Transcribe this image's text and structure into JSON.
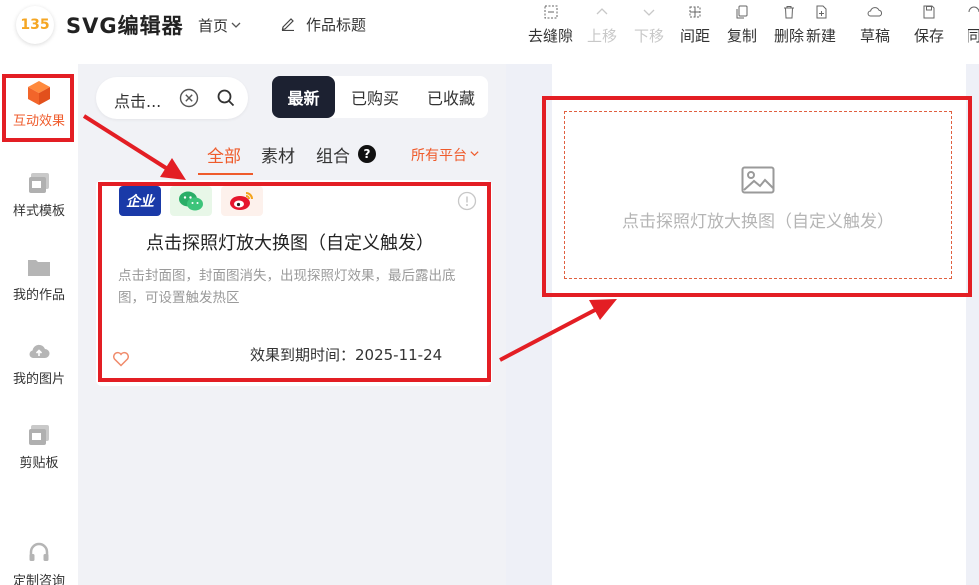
{
  "header": {
    "logo_mark": "135",
    "logo_text": "SVG编辑器",
    "nav_home": "首页",
    "nav_title": "作品标题"
  },
  "toolbar": [
    {
      "label": "去缝隙",
      "icon": "gap-remove-icon",
      "disabled": false
    },
    {
      "label": "上移",
      "icon": "arrow-up-icon",
      "disabled": true
    },
    {
      "label": "下移",
      "icon": "arrow-down-icon",
      "disabled": true
    },
    {
      "label": "间距",
      "icon": "spacing-icon",
      "disabled": false
    },
    {
      "label": "复制",
      "icon": "copy-icon",
      "disabled": false
    },
    {
      "label": "删除",
      "icon": "trash-icon",
      "disabled": false
    },
    {
      "label": "新建",
      "icon": "new-file-icon",
      "disabled": false
    },
    {
      "label": "草稿",
      "icon": "cloud-icon",
      "disabled": false
    },
    {
      "label": "保存",
      "icon": "save-icon",
      "disabled": false
    },
    {
      "label": "同",
      "icon": "sync-icon",
      "disabled": false
    }
  ],
  "sidebar": {
    "items": [
      {
        "label": "互动效果",
        "icon": "cube-icon"
      },
      {
        "label": "样式模板",
        "icon": "template-icon"
      },
      {
        "label": "我的作品",
        "icon": "folder-icon"
      },
      {
        "label": "我的图片",
        "icon": "cloud-upload-icon"
      },
      {
        "label": "剪贴板",
        "icon": "clipboard-icon"
      },
      {
        "label": "定制咨询",
        "icon": "headset-icon"
      }
    ]
  },
  "search": {
    "value": "点击..."
  },
  "segments": {
    "newest": "最新",
    "bought": "已购买",
    "favorites": "已收藏"
  },
  "filter_tabs": {
    "all": "全部",
    "material": "素材",
    "combo": "组合",
    "help": "?",
    "platform": "所有平台"
  },
  "card": {
    "badge_enterprise": "企业",
    "title": "点击探照灯放大换图（自定义触发）",
    "description": "点击封面图，封面图消失，出现探照灯效果，最后露出底图，可设置触发热区",
    "expiry": "效果到期时间：2025-11-24"
  },
  "canvas": {
    "placeholder_text": "点击探照灯放大换图（自定义触发）"
  },
  "colors": {
    "accent": "#ef5b2b",
    "highlight": "#e31e24",
    "segment_active": "#1c2131"
  }
}
